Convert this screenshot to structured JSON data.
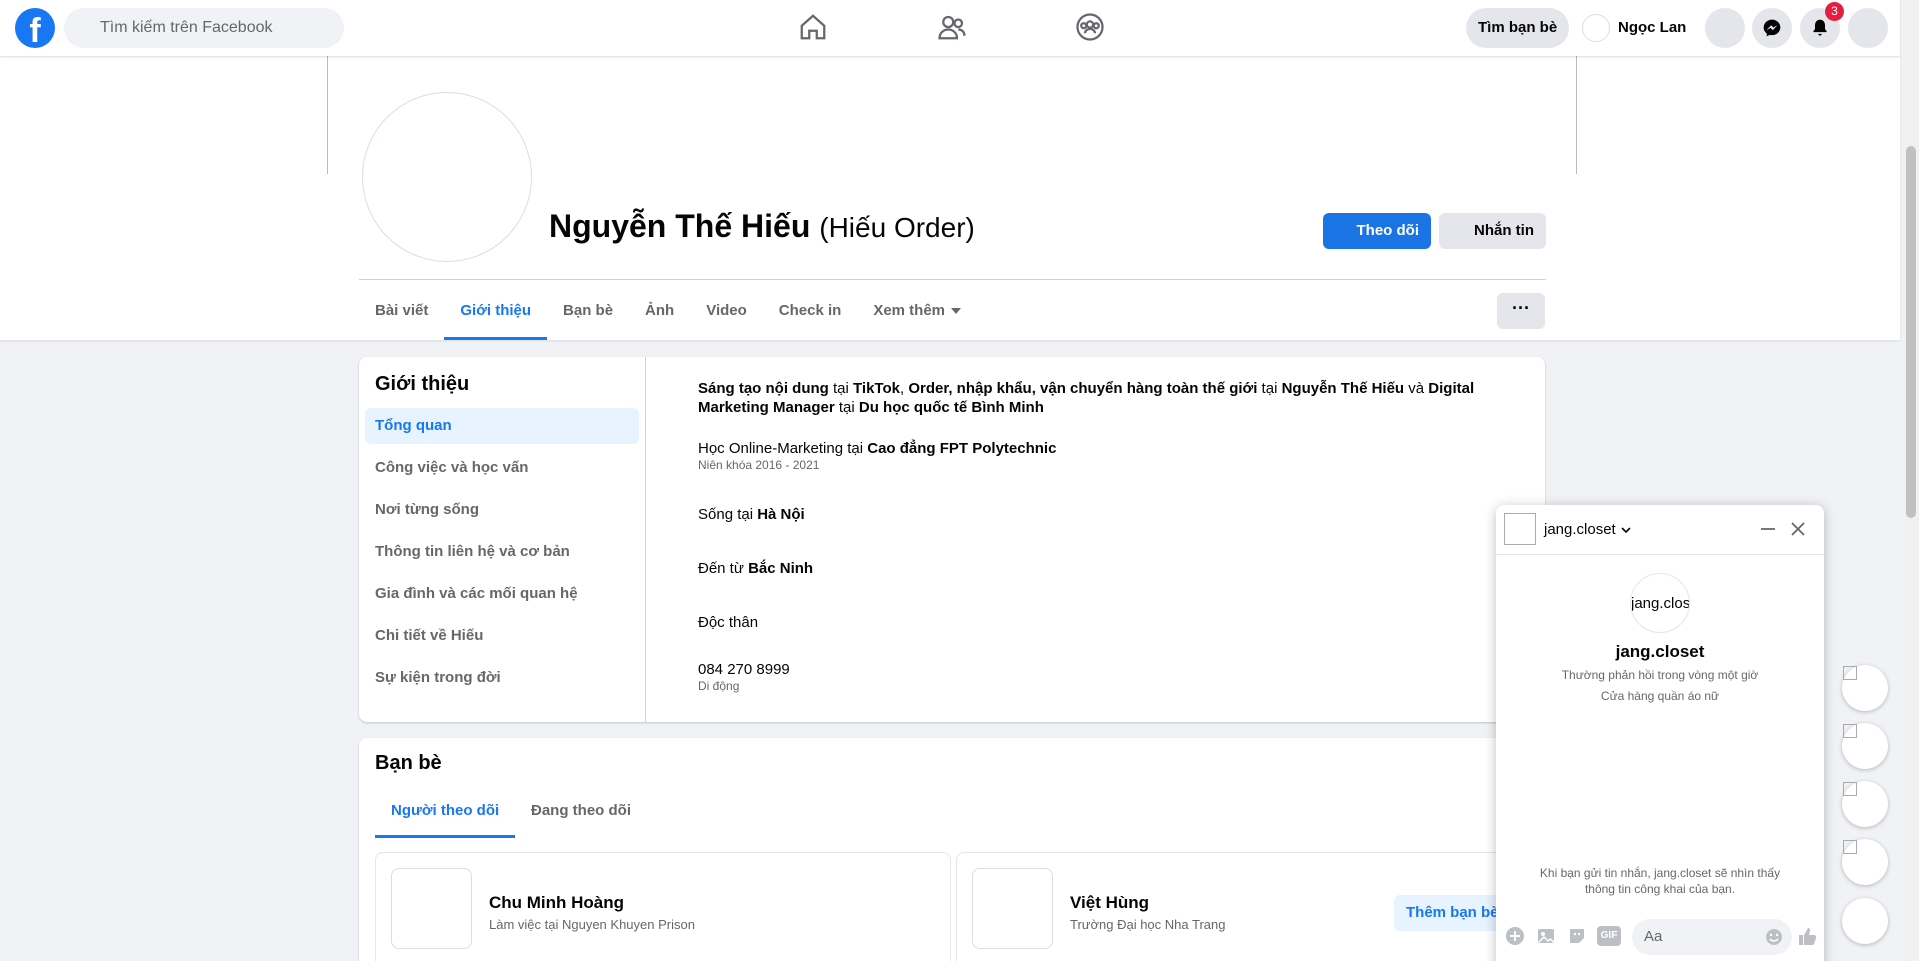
{
  "nav": {
    "logo": "f",
    "search_placeholder": "Tìm kiếm trên Facebook",
    "find_friends": "Tìm bạn bè",
    "user_name": "Ngọc Lan",
    "notification_count": "3"
  },
  "profile": {
    "name": "Nguyễn Thế Hiếu",
    "alt_name": "(Hiếu Order)",
    "follow_label": "Theo dõi",
    "message_label": "Nhắn tin",
    "more_label": "···",
    "tabs": [
      "Bài viết",
      "Giới thiệu",
      "Bạn bè",
      "Ảnh",
      "Video",
      "Check in",
      "Xem thêm"
    ]
  },
  "about": {
    "title": "Giới thiệu",
    "menu": [
      "Tổng quan",
      "Công việc và học vấn",
      "Nơi từng sống",
      "Thông tin liên hệ và cơ bản",
      "Gia đình và các mối quan hệ",
      "Chi tiết về Hiếu",
      "Sự kiện trong đời"
    ],
    "work": {
      "p1": "Sáng tạo nội dung",
      "t1": " tại ",
      "p2": "TikTok",
      "t2": ", ",
      "p3": "Order, nhập khẩu, vận chuyển hàng toàn thế giới",
      "t3": " tại ",
      "p4": "Nguyễn Thế Hiếu",
      "t4": " và ",
      "p5": "Digital Marketing Manager",
      "t5": " tại ",
      "p6": "Du học quốc tế Bình Minh"
    },
    "education": {
      "prefix": "Học Online-Marketing tại ",
      "school": "Cao đẳng FPT Polytechnic",
      "years": "Niên khóa 2016 - 2021"
    },
    "lives": {
      "prefix": "Sống tại ",
      "place": "Hà Nội"
    },
    "from": {
      "prefix": "Đến từ ",
      "place": "Bắc Ninh"
    },
    "relationship": "Độc thân",
    "phone": {
      "number": "084 270 8999",
      "label": "Di động"
    }
  },
  "friends": {
    "title": "Bạn bè",
    "tabs": [
      "Người theo dõi",
      "Đang theo dõi"
    ],
    "cards": [
      {
        "name": "Chu Minh Hoàng",
        "sub": "Làm việc tại Nguyen Khuyen Prison"
      },
      {
        "name": "Việt Hùng",
        "sub": "Trường Đại học Nha Trang",
        "button": "Thêm bạn bè"
      }
    ]
  },
  "chat": {
    "name": "jang.closet",
    "avatar_text": "jang.clos",
    "title": "jang.closet",
    "response": "Thường phản hồi trong vòng một giờ",
    "category": "Cửa hàng quần áo nữ",
    "note": "Khi bạn gửi tin nhắn, jang.closet sẽ nhìn thấy thông tin công khai của bạn.",
    "input_placeholder": "Aa",
    "gif_label": "GIF"
  },
  "colors": {
    "accent": "#1877f2",
    "background": "#f0f2f5",
    "badge": "#e41e3f"
  }
}
